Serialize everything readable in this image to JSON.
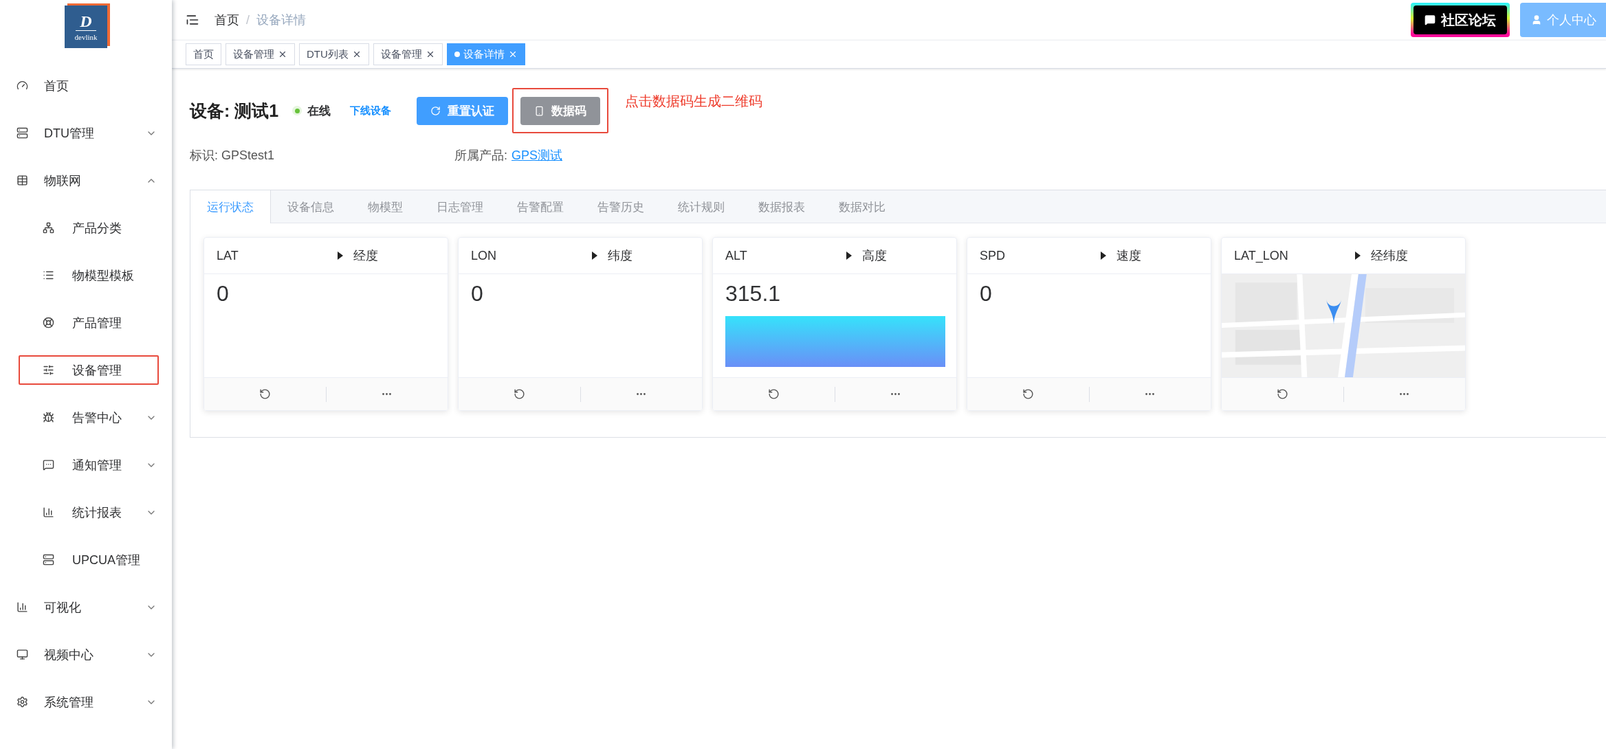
{
  "logo": {
    "letter": "D",
    "name": "devlink"
  },
  "sidebar": {
    "items": [
      {
        "label": "首页"
      },
      {
        "label": "DTU管理",
        "expanded": false
      },
      {
        "label": "物联网",
        "expanded": true,
        "children": [
          {
            "label": "产品分类",
            "annotated": false
          },
          {
            "label": "物模型模板",
            "annotated": false
          },
          {
            "label": "产品管理",
            "annotated": false
          },
          {
            "label": "设备管理",
            "annotated": true
          },
          {
            "label": "告警中心",
            "expanded": false,
            "annotated": false
          },
          {
            "label": "通知管理",
            "expanded": false,
            "annotated": false
          },
          {
            "label": "统计报表",
            "expanded": false,
            "annotated": false
          },
          {
            "label": "UPCUA管理",
            "annotated": false
          }
        ]
      },
      {
        "label": "可视化",
        "expanded": false
      },
      {
        "label": "视频中心",
        "expanded": false
      },
      {
        "label": "系统管理",
        "expanded": false
      }
    ]
  },
  "breadcrumb": [
    "首页",
    "设备详情"
  ],
  "breadcrumb_separator": "/",
  "header_buttons": {
    "forum": "社区论坛",
    "profile": "个人中心"
  },
  "tags": [
    {
      "label": "首页",
      "closable": false,
      "selected": false
    },
    {
      "label": "设备管理",
      "closable": true,
      "selected": false
    },
    {
      "label": "DTU列表",
      "closable": true,
      "selected": false
    },
    {
      "label": "设备管理",
      "closable": true,
      "selected": false
    },
    {
      "label": "设备详情",
      "closable": true,
      "selected": true
    }
  ],
  "device": {
    "title": "设备: 测试1",
    "status": "在线",
    "online": true,
    "offline_link": "下线设备",
    "buttons": [
      {
        "label": "重置认证",
        "kind": "primary",
        "annotated": false
      },
      {
        "label": "数据码",
        "kind": "secondary",
        "annotated": true
      }
    ],
    "annotation": "点击数据码生成二维码",
    "identifier": "标识: GPStest1",
    "product_label": "所属产品:",
    "product": "GPS测试"
  },
  "tabs": [
    {
      "label": "运行状态",
      "selected": true
    },
    {
      "label": "设备信息",
      "selected": false
    },
    {
      "label": "物模型",
      "selected": false
    },
    {
      "label": "日志管理",
      "selected": false
    },
    {
      "label": "告警配置",
      "selected": false
    },
    {
      "label": "告警历史",
      "selected": false
    },
    {
      "label": "统计规则",
      "selected": false
    },
    {
      "label": "数据报表",
      "selected": false
    },
    {
      "label": "数据对比",
      "selected": false
    }
  ],
  "cards": [
    {
      "kind": "value",
      "name": "LAT",
      "label": "经度",
      "value": "0"
    },
    {
      "kind": "value",
      "name": "LON",
      "label": "纬度",
      "value": "0"
    },
    {
      "kind": "bar",
      "name": "ALT",
      "label": "高度",
      "value": "315.1"
    },
    {
      "kind": "value",
      "name": "SPD",
      "label": "速度",
      "value": "0"
    },
    {
      "kind": "map",
      "name": "LAT_LON",
      "label": "经纬度"
    }
  ]
}
